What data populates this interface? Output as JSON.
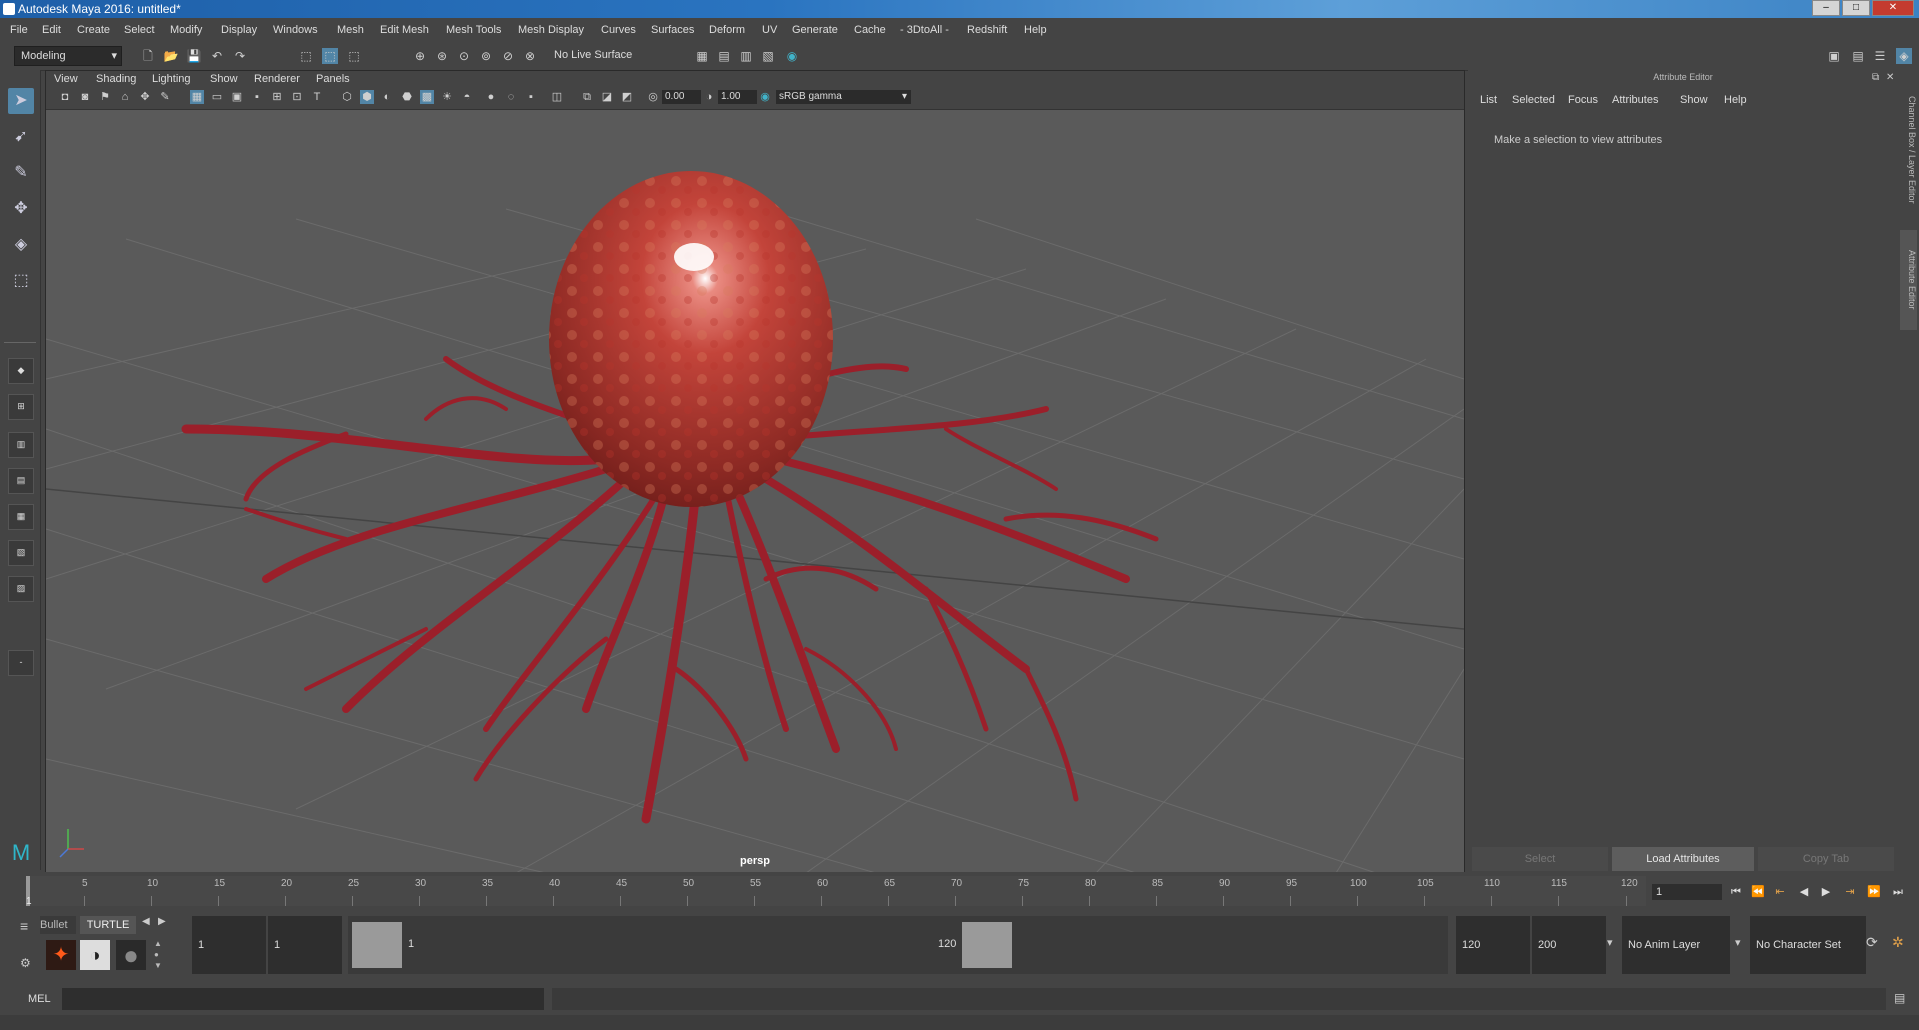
{
  "window": {
    "title": "Autodesk Maya 2016: untitled*"
  },
  "menubar": [
    "File",
    "Edit",
    "Create",
    "Select",
    "Modify",
    "Display",
    "Windows",
    "Mesh",
    "Edit Mesh",
    "Mesh Tools",
    "Mesh Display",
    "Curves",
    "Surfaces",
    "Deform",
    "UV",
    "Generate",
    "Cache",
    "- 3DtoAll -",
    "Redshift",
    "Help"
  ],
  "statusline": {
    "mode": "Modeling",
    "live_surface": "No Live Surface"
  },
  "viewport": {
    "menus": [
      "View",
      "Shading",
      "Lighting",
      "Show",
      "Renderer",
      "Panels"
    ],
    "field_a": "0.00",
    "field_b": "1.00",
    "color_space": "sRGB gamma",
    "camera": "persp"
  },
  "attribute_editor": {
    "title": "Attribute Editor",
    "menus": [
      "List",
      "Selected",
      "Focus",
      "Attributes",
      "Show",
      "Help"
    ],
    "message": "Make a selection to view attributes",
    "buttons": {
      "select": "Select",
      "load": "Load Attributes",
      "copy": "Copy Tab"
    }
  },
  "side_tabs": {
    "channel": "Channel Box / Layer Editor",
    "attr": "Attribute Editor"
  },
  "timeline": {
    "ticks": [
      "1",
      "5",
      "10",
      "15",
      "20",
      "25",
      "30",
      "35",
      "40",
      "45",
      "50",
      "55",
      "60",
      "65",
      "70",
      "75",
      "80",
      "85",
      "90",
      "95",
      "100",
      "105",
      "110",
      "115",
      "120"
    ],
    "current_frame": "1"
  },
  "shelf": {
    "tabs": [
      "Bullet",
      "TURTLE"
    ]
  },
  "range": {
    "start": "1",
    "playback_start": "1",
    "slider_start": "1",
    "slider_end": "120",
    "playback_end": "120",
    "end": "200",
    "anim_layer": "No Anim Layer",
    "character_set": "No Character Set"
  },
  "command_line": {
    "lang": "MEL"
  }
}
